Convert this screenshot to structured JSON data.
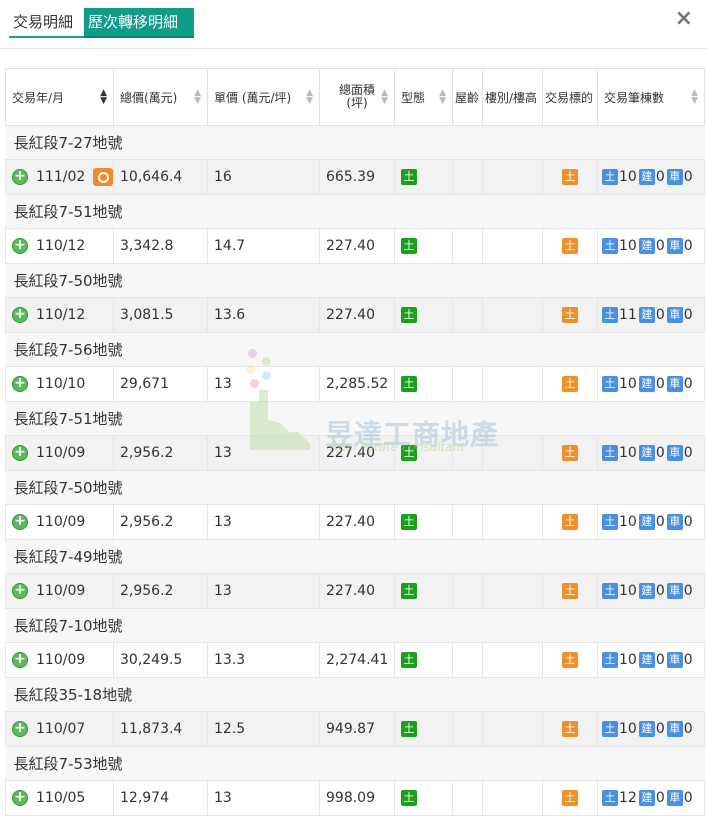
{
  "tabs": [
    {
      "label": "交易明細"
    },
    {
      "label": "歷次轉移明細"
    }
  ],
  "close_label": "×",
  "headers": [
    {
      "label": "交易年/月"
    },
    {
      "label": "總價(萬元)"
    },
    {
      "label": "單價 (萬元/坪)"
    },
    {
      "label": "總面積\n(坪)"
    },
    {
      "label": "型態"
    },
    {
      "label": "屋齡"
    },
    {
      "label": "樓別/樓高"
    },
    {
      "label": "交易標的"
    },
    {
      "label": "交易筆棟數"
    }
  ],
  "rows": [
    {
      "group": "長紅段7-27地號",
      "date": "111/02",
      "total": "10,646.4",
      "unit": "16",
      "area": "665.39",
      "type_badge": "土",
      "target_badge": "土",
      "land": "10",
      "bldg": "0",
      "car": "0",
      "house_icon": true
    },
    {
      "group": "長紅段7-51地號",
      "date": "110/12",
      "total": "3,342.8",
      "unit": "14.7",
      "area": "227.40",
      "type_badge": "土",
      "target_badge": "土",
      "land": "10",
      "bldg": "0",
      "car": "0",
      "house_icon": false
    },
    {
      "group": "長紅段7-50地號",
      "date": "110/12",
      "total": "3,081.5",
      "unit": "13.6",
      "area": "227.40",
      "type_badge": "土",
      "target_badge": "土",
      "land": "11",
      "bldg": "0",
      "car": "0",
      "house_icon": false
    },
    {
      "group": "長紅段7-56地號",
      "date": "110/10",
      "total": "29,671",
      "unit": "13",
      "area": "2,285.52",
      "type_badge": "土",
      "target_badge": "土",
      "land": "10",
      "bldg": "0",
      "car": "0",
      "house_icon": false
    },
    {
      "group": "長紅段7-51地號",
      "date": "110/09",
      "total": "2,956.2",
      "unit": "13",
      "area": "227.40",
      "type_badge": "土",
      "target_badge": "土",
      "land": "10",
      "bldg": "0",
      "car": "0",
      "house_icon": false
    },
    {
      "group": "長紅段7-50地號",
      "date": "110/09",
      "total": "2,956.2",
      "unit": "13",
      "area": "227.40",
      "type_badge": "土",
      "target_badge": "土",
      "land": "10",
      "bldg": "0",
      "car": "0",
      "house_icon": false
    },
    {
      "group": "長紅段7-49地號",
      "date": "110/09",
      "total": "2,956.2",
      "unit": "13",
      "area": "227.40",
      "type_badge": "土",
      "target_badge": "土",
      "land": "10",
      "bldg": "0",
      "car": "0",
      "house_icon": false
    },
    {
      "group": "長紅段7-10地號",
      "date": "110/09",
      "total": "30,249.5",
      "unit": "13.3",
      "area": "2,274.41",
      "type_badge": "土",
      "target_badge": "土",
      "land": "10",
      "bldg": "0",
      "car": "0",
      "house_icon": false
    },
    {
      "group": "長紅段35-18地號",
      "date": "110/07",
      "total": "11,873.4",
      "unit": "12.5",
      "area": "949.87",
      "type_badge": "土",
      "target_badge": "土",
      "land": "10",
      "bldg": "0",
      "car": "0",
      "house_icon": false
    },
    {
      "group": "長紅段7-53地號",
      "date": "110/05",
      "total": "12,974",
      "unit": "13",
      "area": "998.09",
      "type_badge": "土",
      "target_badge": "土",
      "land": "12",
      "bldg": "0",
      "car": "0",
      "house_icon": false
    }
  ],
  "count_labels": {
    "land": "土",
    "bldg": "建",
    "car": "車"
  },
  "watermark": {
    "brand": "昱達工商地產",
    "sub": "Real estate consultant"
  },
  "colors": {
    "tab_active": "#0f9d8a",
    "badge_type": "#1aa01a",
    "badge_target": "#f0902b",
    "badge_count": "#4a90e2"
  }
}
